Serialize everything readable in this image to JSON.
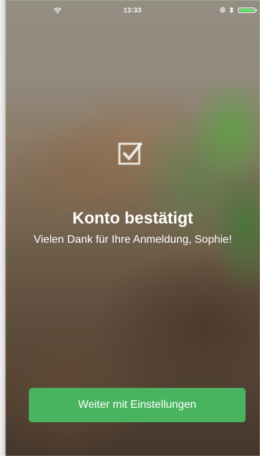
{
  "status_bar": {
    "time": "13:33"
  },
  "confirmation": {
    "title": "Konto bestätigt",
    "message": "Vielen Dank für Ihre Anmeldung, Sophie!"
  },
  "actions": {
    "continue_label": "Weiter mit Einstellungen"
  },
  "icons": {
    "wifi": "wifi-icon",
    "lock_rotation": "lock-rotation-icon",
    "bluetooth": "bluetooth-icon",
    "battery": "battery-icon",
    "checkbox": "checkbox-checked-icon"
  },
  "colors": {
    "primary_button": "#49b45f",
    "text": "#ffffff",
    "battery": "#59e56d"
  }
}
